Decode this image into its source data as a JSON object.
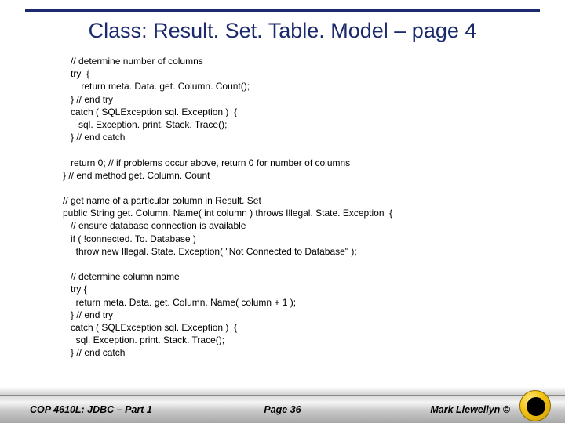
{
  "title": "Class:  Result. Set. Table. Model – page 4",
  "code": "   // determine number of columns\n   try  {\n       return meta. Data. get. Column. Count();\n   } // end try\n   catch ( SQLException sql. Exception )  {\n      sql. Exception. print. Stack. Trace();\n   } // end catch\n\n   return 0; // if problems occur above, return 0 for number of columns\n} // end method get. Column. Count\n\n// get name of a particular column in Result. Set\npublic String get. Column. Name( int column ) throws Illegal. State. Exception  {\n   // ensure database connection is available\n   if ( !connected. To. Database )\n     throw new Illegal. State. Exception( \"Not Connected to Database\" );\n\n   // determine column name\n   try {\n     return meta. Data. get. Column. Name( column + 1 );\n   } // end try\n   catch ( SQLException sql. Exception )  {\n     sql. Exception. print. Stack. Trace();\n   } // end catch",
  "footer": {
    "left": "COP 4610L: JDBC – Part 1",
    "center": "Page 36",
    "right": "Mark Llewellyn ©"
  }
}
